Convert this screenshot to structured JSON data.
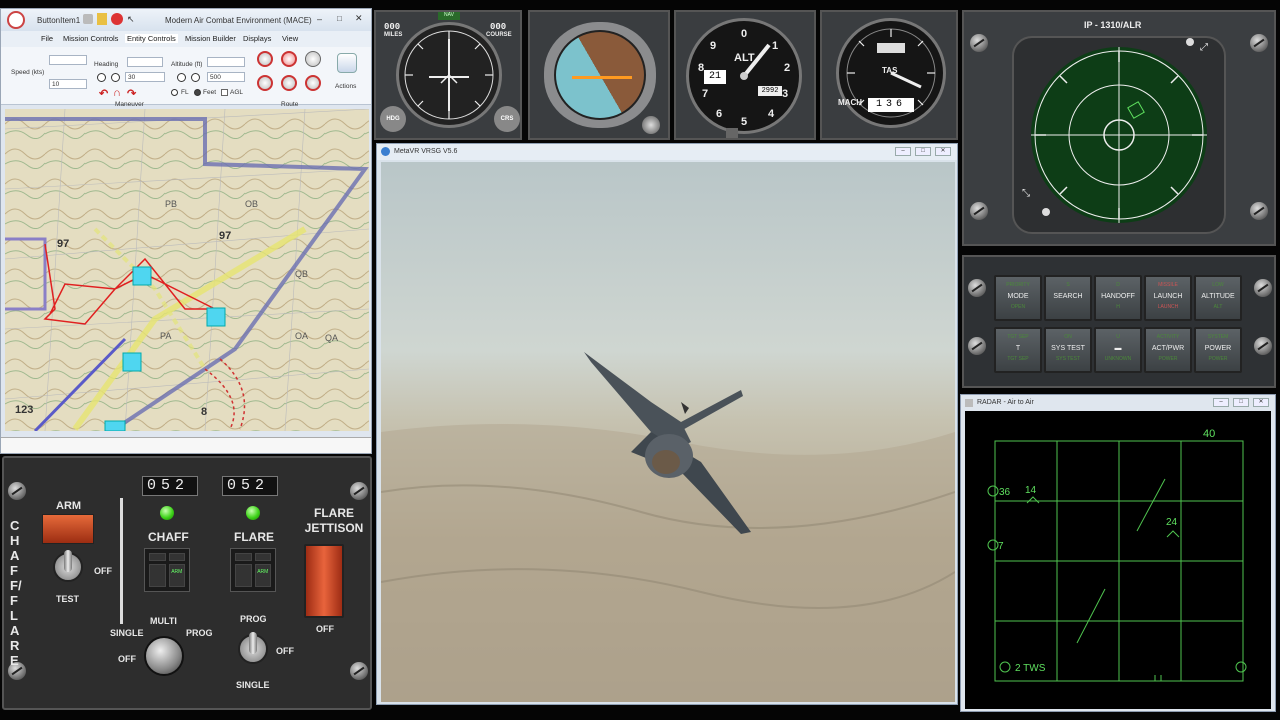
{
  "mace": {
    "qa_button": "ButtonItem1",
    "title": "Modern Air Combat Environment (MACE)",
    "tabs": [
      "File",
      "Mission Controls",
      "Entity Controls",
      "Mission Builder",
      "Displays",
      "View"
    ],
    "speed_label": "Speed (kts)",
    "speed_value": "10",
    "heading_label": "Heading",
    "heading_value": "30",
    "altitude_label": "Altitude (ft)",
    "altitude_value": "500",
    "fl_label": "FL",
    "feet_label": "Feet",
    "agl_label": "AGL",
    "maneuver_label": "Maneuver",
    "route_label": "Route",
    "actions_label": "Actions",
    "map_labels": [
      "97",
      "97",
      "123",
      "8",
      "PB",
      "PA",
      "OB",
      "OA",
      "QB",
      "QA"
    ]
  },
  "chaff": {
    "side_label": "CHAFF/FLARE",
    "arm_label": "ARM",
    "off_label": "OFF",
    "test_label": "TEST",
    "chaff_count": "052",
    "flare_count": "052",
    "chaff_label": "CHAFF",
    "flare_label": "FLARE",
    "flare_jettison": "FLARE JETTISON",
    "jettison_off": "OFF",
    "single_label": "SINGLE",
    "multi_label": "MULTI",
    "prog_label": "PROG",
    "knob_off": "OFF",
    "prog2": "PROG",
    "off2": "OFF",
    "single2": "SINGLE",
    "arm_small": "ARM"
  },
  "instruments": {
    "hsi": {
      "miles": "MILES",
      "course": "COURSE",
      "top_miles": "000",
      "top_course": "000",
      "hdg": "HDG",
      "crs": "CRS"
    },
    "alt": {
      "label": "ALT",
      "digits": "21",
      "kollsman": "2992"
    },
    "tas": {
      "label": "TAS",
      "mach_label": "MACH",
      "mach_value": "136"
    }
  },
  "vrsg": {
    "title": "MetaVR VRSG V5.6"
  },
  "ip": {
    "title": "IP - 1310/ALR"
  },
  "hud_buttons": [
    {
      "top": "PRIORITY",
      "main": "MODE",
      "bottom": "OPEN"
    },
    {
      "top": "S",
      "main": "SEARCH",
      "bottom": ""
    },
    {
      "top": "D",
      "main": "HANDOFF",
      "bottom": "H"
    },
    {
      "top": "MISSILE",
      "main": "LAUNCH",
      "bottom": "LAUNCH"
    },
    {
      "top": "LOW",
      "main": "ALTITUDE",
      "bottom": "ALT"
    },
    {
      "top": "TGT SEP",
      "main": "T",
      "bottom": "TGT SEP"
    },
    {
      "top": "ON",
      "main": "SYS TEST",
      "bottom": "SYS TEST"
    },
    {
      "top": "U",
      "main": "",
      "bottom": "UNKNOWN"
    },
    {
      "top": "ACTIVITY",
      "main": "ACT/PWR",
      "bottom": "POWER"
    },
    {
      "top": "SYSTEM",
      "main": "POWER",
      "bottom": "POWER"
    }
  ],
  "radar": {
    "title": "RADAR - Air to Air",
    "range": "40",
    "alt_36": "36",
    "alt_7": "7",
    "tgt1": "14",
    "tgt2": "24",
    "mode": "2 TWS"
  }
}
